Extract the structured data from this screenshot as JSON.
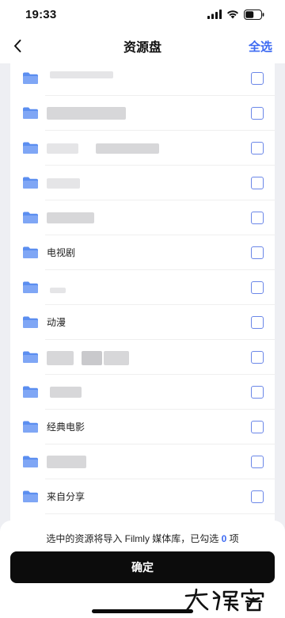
{
  "status_bar": {
    "time": "19:33",
    "icons": [
      "signal-icon",
      "wifi-icon",
      "battery-icon"
    ]
  },
  "nav": {
    "back_icon": "chevron-left-icon",
    "title": "资源盘",
    "select_all_label": "全选"
  },
  "accent_color": "#3d6af2",
  "folder_color": "#5b8ef0",
  "folder_list": {
    "items": [
      {
        "label": "",
        "checked": false
      },
      {
        "label": "",
        "checked": false
      },
      {
        "label": "",
        "checked": false
      },
      {
        "label": "",
        "checked": false
      },
      {
        "label": "",
        "checked": false
      },
      {
        "label": "电视剧",
        "checked": false
      },
      {
        "label": "",
        "checked": false
      },
      {
        "label": "动漫",
        "checked": false
      },
      {
        "label": "",
        "checked": false
      },
      {
        "label": "",
        "checked": false
      },
      {
        "label": "经典电影",
        "checked": false
      },
      {
        "label": "",
        "checked": false
      },
      {
        "label": "来自分享",
        "checked": false
      }
    ]
  },
  "footer": {
    "text_before": "选中的资源将导入 Filmly 媒体库，已勾选 ",
    "selected_count": "0",
    "text_after": " 项",
    "confirm_label": "确定"
  }
}
